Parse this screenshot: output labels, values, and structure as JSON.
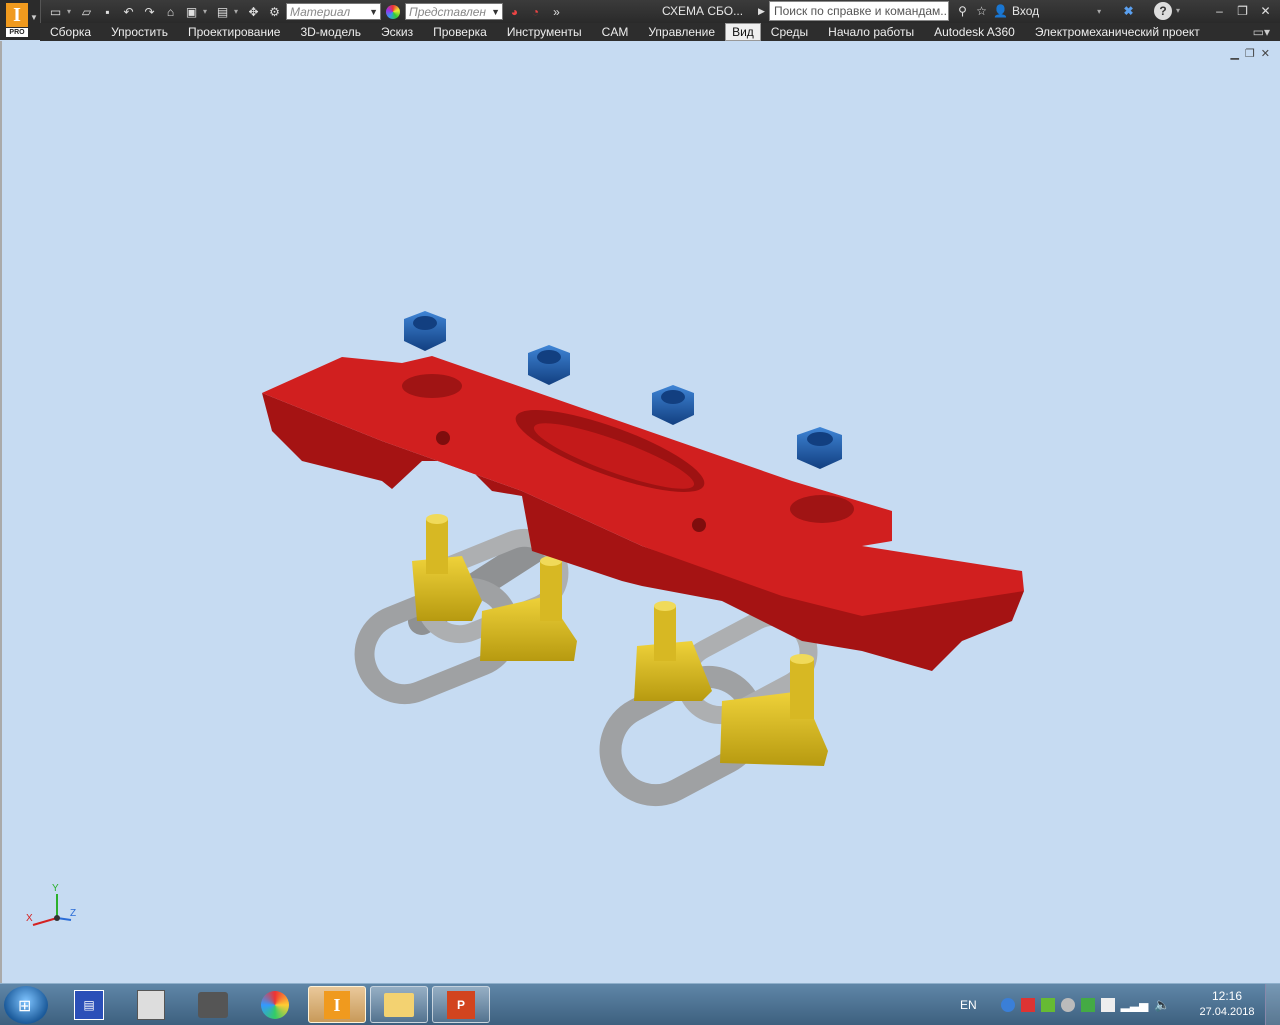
{
  "app": {
    "pro_badge": "PRO",
    "doc_title": "СХЕМА СБО...",
    "search_placeholder": "Поиск по справке и командам...",
    "login": "Вход"
  },
  "qat": {
    "material": "Материал",
    "representation": "Представлен"
  },
  "menu": [
    {
      "label": "Сборка"
    },
    {
      "label": "Упростить"
    },
    {
      "label": "Проектирование"
    },
    {
      "label": "3D-модель"
    },
    {
      "label": "Эскиз"
    },
    {
      "label": "Проверка"
    },
    {
      "label": "Инструменты"
    },
    {
      "label": "CAM"
    },
    {
      "label": "Управление"
    },
    {
      "label": "Вид",
      "active": true
    },
    {
      "label": "Среды"
    },
    {
      "label": "Начало работы"
    },
    {
      "label": "Autodesk A360"
    },
    {
      "label": "Электромеханический проект"
    }
  ],
  "triad": {
    "x": "X",
    "y": "Y",
    "z": "Z"
  },
  "taskbar": {
    "lang": "EN",
    "time": "12:16",
    "date": "27.04.2018",
    "apps": [
      "save-app-icon",
      "calculator-icon",
      "scanner-icon",
      "paint-icon",
      "inventor-icon",
      "explorer-icon",
      "powerpoint-icon"
    ]
  },
  "colors": {
    "viewport_bg": "#c6dbf2",
    "part_red": "#c41a1a",
    "nut_blue": "#1f5fb0",
    "base_yellow": "#e2c019",
    "chain_gray": "#a7a9ab"
  }
}
